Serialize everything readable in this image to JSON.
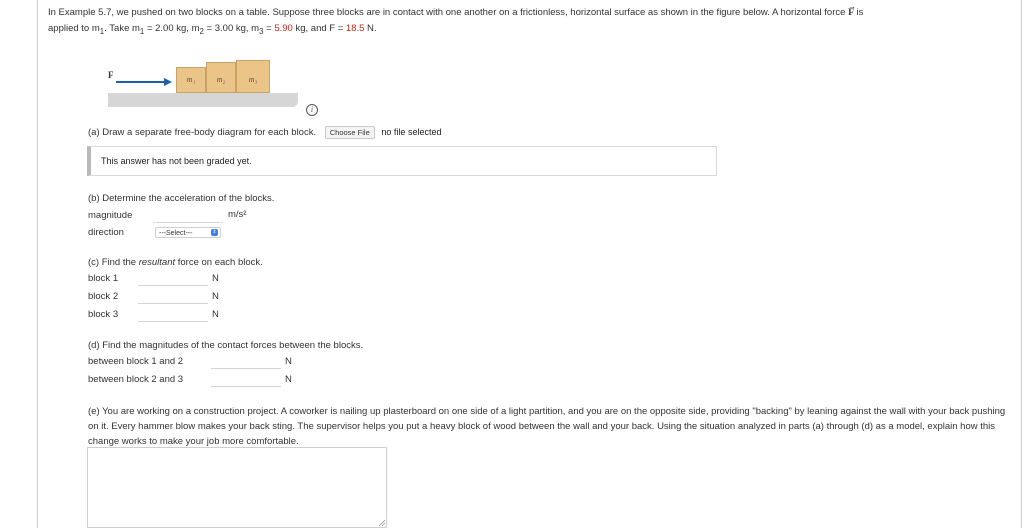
{
  "problem": {
    "line1": "In Example 5.7, we pushed on two blocks on a table. Suppose three blocks are in contact with one another on a frictionless, horizontal surface as shown in the figure below. A horizontal force",
    "force_symbol": "F",
    "line1_end": "is",
    "line2_a": "applied to m",
    "sub1": "1",
    "line2_b": ". Take m",
    "line2_c": " = 2.00 kg, m",
    "sub2": "2",
    "line2_d": " = 3.00 kg, m",
    "sub3": "3",
    "line2_e": " = ",
    "m3_value": "5.90",
    "line2_f": " kg, and F = ",
    "f_value": "18.5",
    "line2_g": " N."
  },
  "figure": {
    "force_label": "F",
    "block1": "m₁",
    "block2": "m₂",
    "block3": "m₃",
    "info": "i"
  },
  "part_a": {
    "prompt": "(a) Draw a separate free-body diagram for each block.",
    "choose_file": "Choose File",
    "file_status": "no file selected",
    "graded_msg": "This answer has not been graded yet."
  },
  "part_b": {
    "prompt": "(b) Determine the acceleration of the blocks.",
    "magnitude_label": "magnitude",
    "magnitude_unit": "m/s²",
    "direction_label": "direction",
    "direction_select": "---Select---"
  },
  "part_c": {
    "prompt_a": "(c) Find the ",
    "prompt_em": "resultant",
    "prompt_b": " force on each block.",
    "rows": [
      {
        "label": "block 1",
        "unit": "N"
      },
      {
        "label": "block 2",
        "unit": "N"
      },
      {
        "label": "block 3",
        "unit": "N"
      }
    ]
  },
  "part_d": {
    "prompt": "(d) Find the magnitudes of the contact forces between the blocks.",
    "rows": [
      {
        "label": "between block 1 and 2",
        "unit": "N"
      },
      {
        "label": "between block 2 and 3",
        "unit": "N"
      }
    ]
  },
  "part_e": {
    "text": "(e) You are working on a construction project. A coworker is nailing up plasterboard on one side of a light partition, and you are on the opposite side, providing \"backing\" by leaning against the wall with your back pushing on it. Every hammer blow makes your back sting. The supervisor helps you put a heavy block of wood between the wall and your back. Using the situation analyzed in parts (a) through (d) as a model, explain how this change works to make your job more comfortable."
  },
  "colors": {
    "highlight": "#c0281c",
    "block_fill": "#ebc488",
    "arrow": "#1f5fa8"
  }
}
